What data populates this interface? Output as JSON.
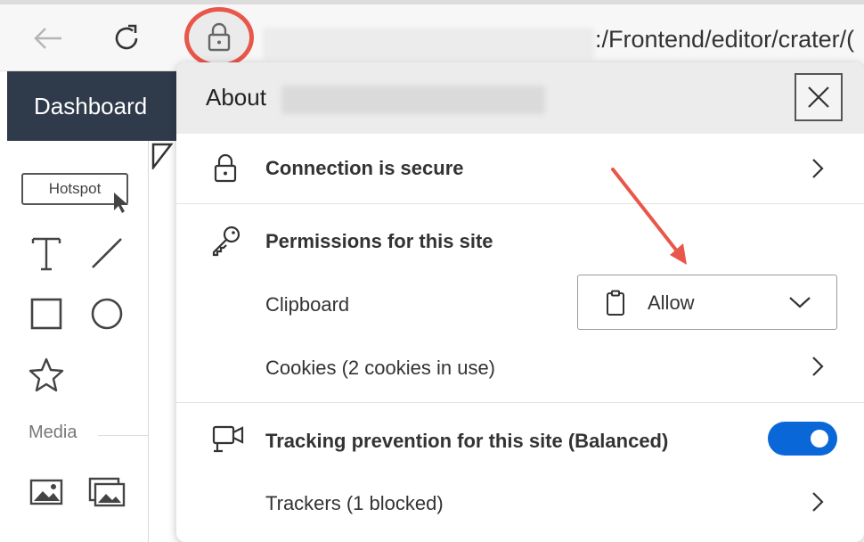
{
  "browser": {
    "url_visible_text": ":/Frontend/editor/crater/("
  },
  "app": {
    "dashboard_label": "Dashboard",
    "hotspot_label": "Hotspot",
    "media_label": "Media"
  },
  "site_info_popup": {
    "about_label": "About",
    "connection_label": "Connection is secure",
    "permissions_heading": "Permissions for this site",
    "clipboard_label": "Clipboard",
    "clipboard_value": "Allow",
    "cookies_label": "Cookies (2 cookies in use)",
    "tracking_label": "Tracking prevention for this site (Balanced)",
    "tracking_enabled": true,
    "trackers_label": "Trackers (1 blocked)"
  },
  "colors": {
    "annotation_red": "#e8574a",
    "toggle_blue": "#0a67d8",
    "dashboard_bg": "#2f3a4a"
  }
}
